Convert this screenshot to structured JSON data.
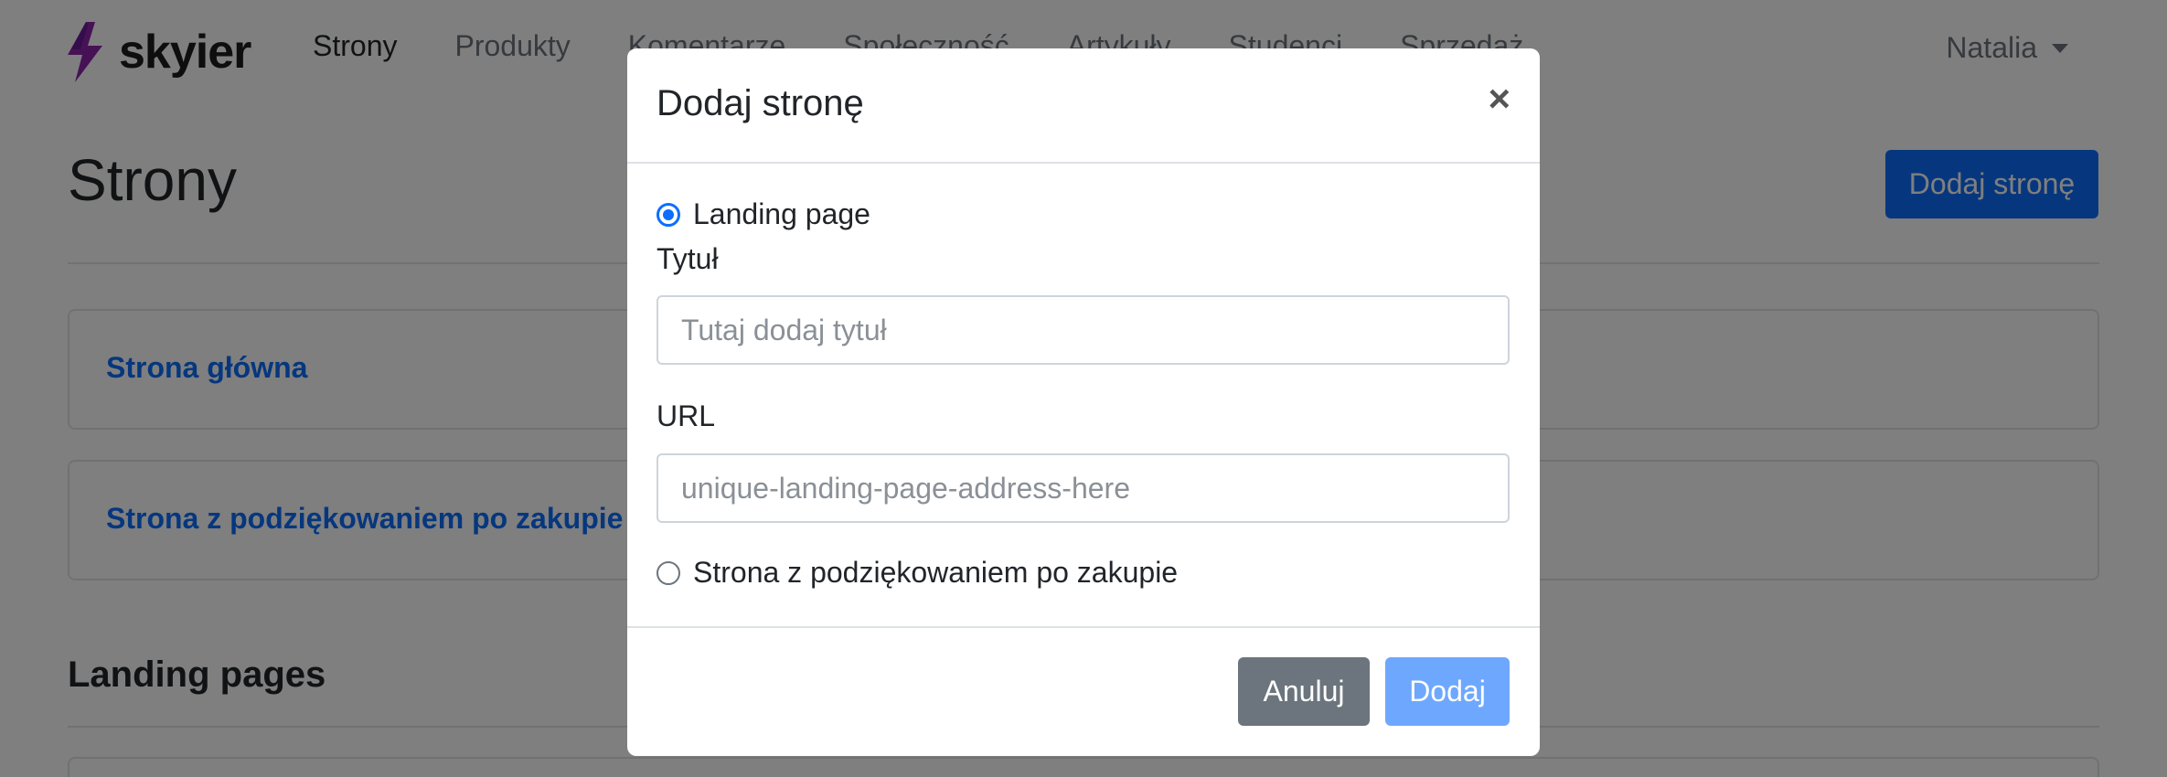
{
  "navbar": {
    "brand_name": "skyier",
    "links": [
      "Strony",
      "Produkty",
      "Komentarze",
      "Społeczność",
      "Artykuły",
      "Studenci",
      "Sprzedaż"
    ],
    "active_link": "Strony",
    "user_name": "Natalia"
  },
  "page": {
    "title": "Strony",
    "add_button_label": "Dodaj stronę",
    "pages": [
      "Strona główna",
      "Strona z podziękowaniem po zakupie"
    ],
    "landing_section_title": "Landing pages"
  },
  "modal": {
    "title": "Dodaj stronę",
    "close_symbol": "×",
    "option_landing_label": "Landing page",
    "option_landing_checked": true,
    "title_field_label": "Tytuł",
    "title_field_placeholder": "Tutaj dodaj tytuł",
    "title_field_value": "",
    "url_field_label": "URL",
    "url_field_placeholder": "unique-landing-page-address-here",
    "url_field_value": "",
    "option_thankyou_label": "Strona z podziękowaniem po zakupie",
    "option_thankyou_checked": false,
    "cancel_label": "Anuluj",
    "submit_label": "Dodaj"
  },
  "colors": {
    "primary": "#0d6efd",
    "primary_disabled": "#6ea8fe",
    "secondary": "#6c757d",
    "brand_bolt": "#8e24aa",
    "backdrop": "rgba(0,0,0,0.5)"
  }
}
